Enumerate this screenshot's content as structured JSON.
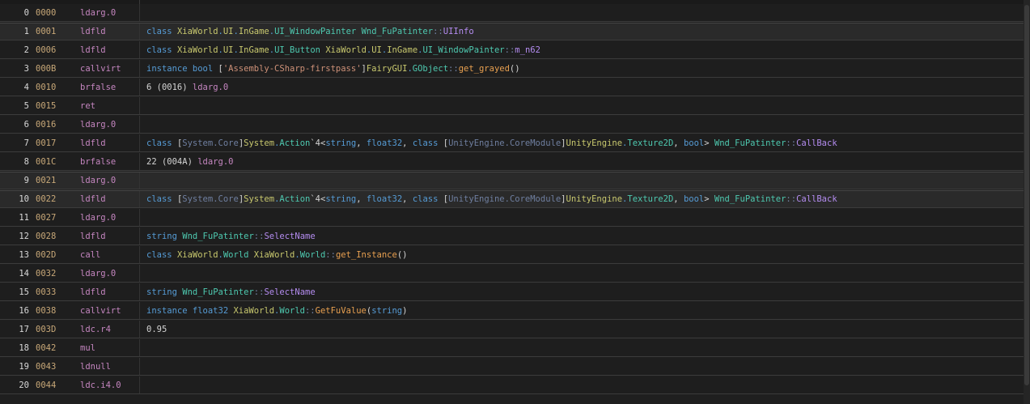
{
  "rows": [
    {
      "index": "0",
      "offset": "0000",
      "opcode": "ldarg.0",
      "operand": [],
      "highlight": false
    },
    {
      "index": "1",
      "offset": "0001",
      "opcode": "ldfld",
      "operand": [
        [
          "kw",
          "class "
        ],
        [
          "ns",
          "XiaWorld"
        ],
        [
          "kw",
          "."
        ],
        [
          "ns",
          "UI"
        ],
        [
          "kw",
          "."
        ],
        [
          "ns",
          "InGame"
        ],
        [
          "kw",
          "."
        ],
        [
          "ty",
          "UI_WindowPainter"
        ],
        [
          "kw",
          " "
        ],
        [
          "ty",
          "Wnd_FuPatinter"
        ],
        [
          "dim",
          "::"
        ],
        [
          "mem",
          "UIInfo"
        ]
      ],
      "highlight": true
    },
    {
      "index": "2",
      "offset": "0006",
      "opcode": "ldfld",
      "operand": [
        [
          "kw",
          "class "
        ],
        [
          "ns",
          "XiaWorld"
        ],
        [
          "kw",
          "."
        ],
        [
          "ns",
          "UI"
        ],
        [
          "kw",
          "."
        ],
        [
          "ns",
          "InGame"
        ],
        [
          "kw",
          "."
        ],
        [
          "ty",
          "UI_Button"
        ],
        [
          "kw",
          " "
        ],
        [
          "ns",
          "XiaWorld"
        ],
        [
          "kw",
          "."
        ],
        [
          "ns",
          "UI"
        ],
        [
          "kw",
          "."
        ],
        [
          "ns",
          "InGame"
        ],
        [
          "kw",
          "."
        ],
        [
          "ty",
          "UI_WindowPainter"
        ],
        [
          "dim",
          "::"
        ],
        [
          "mem",
          "m_n62"
        ]
      ],
      "highlight": false
    },
    {
      "index": "3",
      "offset": "000B",
      "opcode": "callvirt",
      "operand": [
        [
          "kw",
          "instance bool "
        ],
        [
          "num",
          "["
        ],
        [
          "str",
          "'Assembly-CSharp-firstpass'"
        ],
        [
          "num",
          "]"
        ],
        [
          "ns",
          "FairyGUI"
        ],
        [
          "kw",
          "."
        ],
        [
          "ty",
          "GObject"
        ],
        [
          "dim",
          "::"
        ],
        [
          "fn",
          "get_grayed"
        ],
        [
          "num",
          "()"
        ]
      ],
      "highlight": false
    },
    {
      "index": "4",
      "offset": "0010",
      "opcode": "brfalse",
      "operand": [
        [
          "num",
          "6 (0016) "
        ],
        [
          "lbl",
          "ldarg.0"
        ]
      ],
      "highlight": false
    },
    {
      "index": "5",
      "offset": "0015",
      "opcode": "ret",
      "operand": [],
      "highlight": false
    },
    {
      "index": "6",
      "offset": "0016",
      "opcode": "ldarg.0",
      "operand": [],
      "highlight": false
    },
    {
      "index": "7",
      "offset": "0017",
      "opcode": "ldfld",
      "operand": [
        [
          "kw",
          "class "
        ],
        [
          "num",
          "["
        ],
        [
          "dim",
          "System.Core"
        ],
        [
          "num",
          "]"
        ],
        [
          "ns",
          "System"
        ],
        [
          "kw",
          "."
        ],
        [
          "ty",
          "Action"
        ],
        [
          "num",
          "`4<"
        ],
        [
          "kw",
          "string"
        ],
        [
          "num",
          ", "
        ],
        [
          "kw",
          "float32"
        ],
        [
          "num",
          ", "
        ],
        [
          "kw",
          "class "
        ],
        [
          "num",
          "["
        ],
        [
          "dim",
          "UnityEngine.CoreModule"
        ],
        [
          "num",
          "]"
        ],
        [
          "ns",
          "UnityEngine"
        ],
        [
          "kw",
          "."
        ],
        [
          "ty",
          "Texture2D"
        ],
        [
          "num",
          ", "
        ],
        [
          "kw",
          "bool"
        ],
        [
          "num",
          "> "
        ],
        [
          "ty",
          "Wnd_FuPatinter"
        ],
        [
          "dim",
          "::"
        ],
        [
          "mem",
          "CallBack"
        ]
      ],
      "highlight": false
    },
    {
      "index": "8",
      "offset": "001C",
      "opcode": "brfalse",
      "operand": [
        [
          "num",
          "22 (004A) "
        ],
        [
          "lbl",
          "ldarg.0"
        ]
      ],
      "highlight": false
    },
    {
      "index": "9",
      "offset": "0021",
      "opcode": "ldarg.0",
      "operand": [],
      "highlight": true
    },
    {
      "index": "10",
      "offset": "0022",
      "opcode": "ldfld",
      "operand": [
        [
          "kw",
          "class "
        ],
        [
          "num",
          "["
        ],
        [
          "dim",
          "System.Core"
        ],
        [
          "num",
          "]"
        ],
        [
          "ns",
          "System"
        ],
        [
          "kw",
          "."
        ],
        [
          "ty",
          "Action"
        ],
        [
          "num",
          "`4<"
        ],
        [
          "kw",
          "string"
        ],
        [
          "num",
          ", "
        ],
        [
          "kw",
          "float32"
        ],
        [
          "num",
          ", "
        ],
        [
          "kw",
          "class "
        ],
        [
          "num",
          "["
        ],
        [
          "dim",
          "UnityEngine.CoreModule"
        ],
        [
          "num",
          "]"
        ],
        [
          "ns",
          "UnityEngine"
        ],
        [
          "kw",
          "."
        ],
        [
          "ty",
          "Texture2D"
        ],
        [
          "num",
          ", "
        ],
        [
          "kw",
          "bool"
        ],
        [
          "num",
          "> "
        ],
        [
          "ty",
          "Wnd_FuPatinter"
        ],
        [
          "dim",
          "::"
        ],
        [
          "mem",
          "CallBack"
        ]
      ],
      "highlight": true
    },
    {
      "index": "11",
      "offset": "0027",
      "opcode": "ldarg.0",
      "operand": [],
      "highlight": false
    },
    {
      "index": "12",
      "offset": "0028",
      "opcode": "ldfld",
      "operand": [
        [
          "kw",
          "string "
        ],
        [
          "ty",
          "Wnd_FuPatinter"
        ],
        [
          "dim",
          "::"
        ],
        [
          "mem",
          "SelectName"
        ]
      ],
      "highlight": false
    },
    {
      "index": "13",
      "offset": "002D",
      "opcode": "call",
      "operand": [
        [
          "kw",
          "class "
        ],
        [
          "ns",
          "XiaWorld"
        ],
        [
          "kw",
          "."
        ],
        [
          "ty",
          "World"
        ],
        [
          "kw",
          " "
        ],
        [
          "ns",
          "XiaWorld"
        ],
        [
          "kw",
          "."
        ],
        [
          "ty",
          "World"
        ],
        [
          "dim",
          "::"
        ],
        [
          "fn",
          "get_Instance"
        ],
        [
          "num",
          "()"
        ]
      ],
      "highlight": false
    },
    {
      "index": "14",
      "offset": "0032",
      "opcode": "ldarg.0",
      "operand": [],
      "highlight": false
    },
    {
      "index": "15",
      "offset": "0033",
      "opcode": "ldfld",
      "operand": [
        [
          "kw",
          "string "
        ],
        [
          "ty",
          "Wnd_FuPatinter"
        ],
        [
          "dim",
          "::"
        ],
        [
          "mem",
          "SelectName"
        ]
      ],
      "highlight": false
    },
    {
      "index": "16",
      "offset": "0038",
      "opcode": "callvirt",
      "operand": [
        [
          "kw",
          "instance float32 "
        ],
        [
          "ns",
          "XiaWorld"
        ],
        [
          "kw",
          "."
        ],
        [
          "ty",
          "World"
        ],
        [
          "dim",
          "::"
        ],
        [
          "fn",
          "GetFuValue"
        ],
        [
          "num",
          "("
        ],
        [
          "kw",
          "string"
        ],
        [
          "num",
          ")"
        ]
      ],
      "highlight": false
    },
    {
      "index": "17",
      "offset": "003D",
      "opcode": "ldc.r4",
      "operand": [
        [
          "num",
          "0.95"
        ]
      ],
      "highlight": false
    },
    {
      "index": "18",
      "offset": "0042",
      "opcode": "mul",
      "operand": [],
      "highlight": false
    },
    {
      "index": "19",
      "offset": "0043",
      "opcode": "ldnull",
      "operand": [],
      "highlight": false
    },
    {
      "index": "20",
      "offset": "0044",
      "opcode": "ldc.i4.0",
      "operand": [],
      "highlight": false
    }
  ]
}
